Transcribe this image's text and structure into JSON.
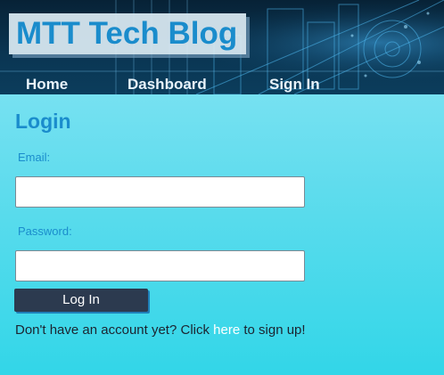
{
  "header": {
    "brand": "MTT Tech Blog",
    "nav": {
      "home": "Home",
      "dashboard": "Dashboard",
      "sign_in": "Sign In"
    }
  },
  "login": {
    "title": "Login",
    "email_label": "Email:",
    "email_value": "",
    "password_label": "Password:",
    "password_value": "",
    "submit_label": "Log In",
    "signup_prefix": "Don't have an account yet? Click ",
    "signup_link": "here",
    "signup_suffix": " to sign up!"
  },
  "colors": {
    "accent": "#1a8ccc",
    "header_bg": "#0a3552",
    "button_bg": "#2c3a4f",
    "page_bg_top": "#8ee6f6",
    "page_bg_bottom": "#32d6e8"
  }
}
